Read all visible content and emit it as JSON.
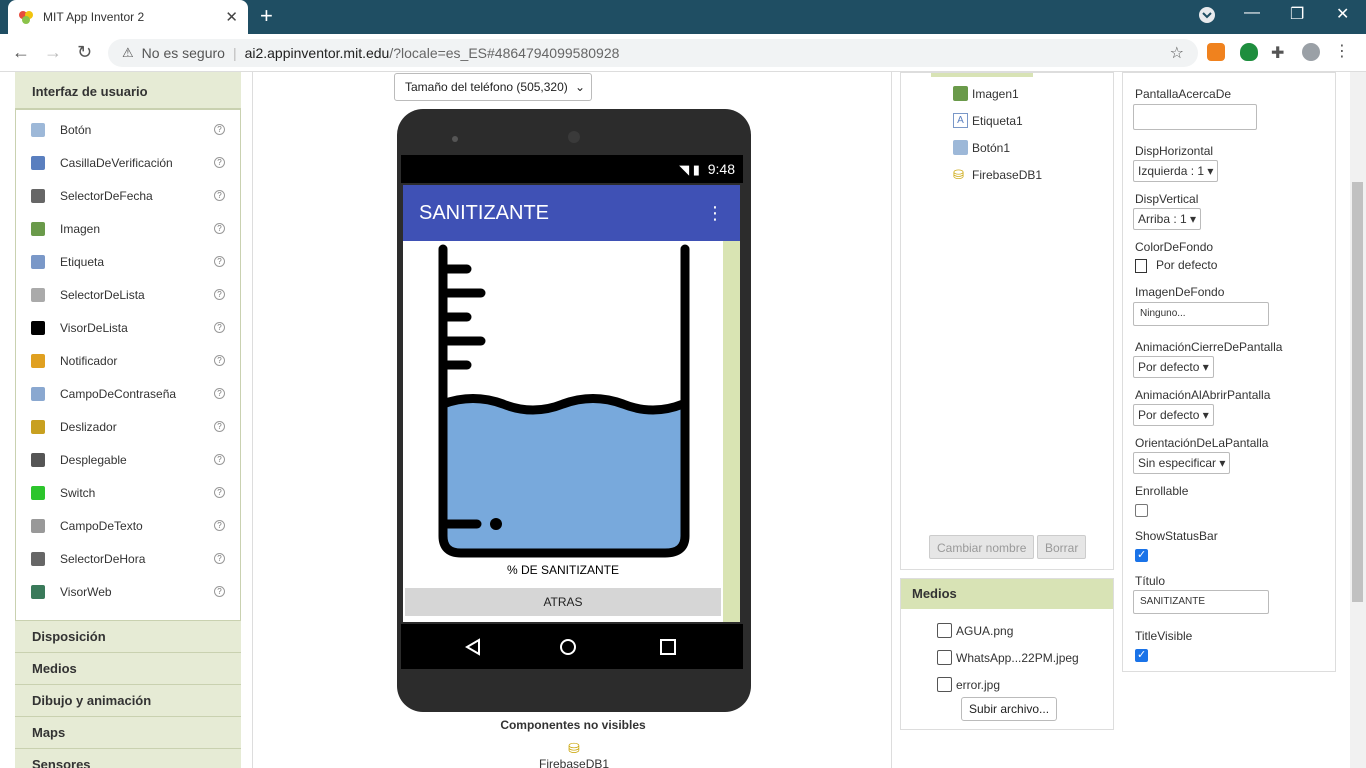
{
  "browser": {
    "tab_title": "MIT App Inventor 2",
    "tab_close": "✕",
    "new_tab": "+",
    "security": "No es seguro",
    "url_host": "ai2.appinventor.mit.edu",
    "url_path": "/?locale=es_ES#4864794099580928",
    "window_controls": [
      "—",
      "❐",
      "✕"
    ]
  },
  "palette": {
    "header": "Interfaz de usuario",
    "items": [
      {
        "label": "Botón",
        "icon": "button-icon",
        "color": "#9db8d8"
      },
      {
        "label": "CasillaDeVerificación",
        "icon": "checkbox-icon",
        "color": "#5a7fbf"
      },
      {
        "label": "SelectorDeFecha",
        "icon": "date-picker-icon",
        "color": "#666"
      },
      {
        "label": "Imagen",
        "icon": "image-icon",
        "color": "#6a9a4a"
      },
      {
        "label": "Etiqueta",
        "icon": "label-icon",
        "color": "#7a98c8"
      },
      {
        "label": "SelectorDeLista",
        "icon": "list-picker-icon",
        "color": "#aaa"
      },
      {
        "label": "VisorDeLista",
        "icon": "list-view-icon",
        "color": "#000"
      },
      {
        "label": "Notificador",
        "icon": "notifier-icon",
        "color": "#e0a020"
      },
      {
        "label": "CampoDeContraseña",
        "icon": "password-icon",
        "color": "#8aa8d0"
      },
      {
        "label": "Deslizador",
        "icon": "slider-icon",
        "color": "#c8a020"
      },
      {
        "label": "Desplegable",
        "icon": "spinner-icon",
        "color": "#555"
      },
      {
        "label": "Switch",
        "icon": "switch-icon",
        "color": "#2cc52c"
      },
      {
        "label": "CampoDeTexto",
        "icon": "textbox-icon",
        "color": "#999"
      },
      {
        "label": "SelectorDeHora",
        "icon": "time-picker-icon",
        "color": "#666"
      },
      {
        "label": "VisorWeb",
        "icon": "webviewer-icon",
        "color": "#3a7a5a"
      }
    ],
    "categories": [
      "Disposición",
      "Medios",
      "Dibujo y animación",
      "Maps",
      "Sensores"
    ]
  },
  "viewer": {
    "size_select": "Tamaño del teléfono (505,320)",
    "status_time": "9:48",
    "app_title": "SANITIZANTE",
    "caption": "% DE SANITIZANTE",
    "button": "ATRAS",
    "nonvisible_header": "Componentes no visibles",
    "nonvisible_item": "FirebaseDB1"
  },
  "components": {
    "items": [
      "Imagen1",
      "Etiqueta1",
      "Botón1",
      "FirebaseDB1"
    ],
    "rename": "Cambiar nombre",
    "delete": "Borrar"
  },
  "media": {
    "header": "Medios",
    "files": [
      "AGUA.png",
      "WhatsApp...22PM.jpeg",
      "error.jpg"
    ],
    "upload": "Subir archivo..."
  },
  "properties": {
    "about_label": "PantallaAcercaDe",
    "halign_label": "DispHorizontal",
    "halign_value": "Izquierda : 1",
    "valign_label": "DispVertical",
    "valign_value": "Arriba : 1",
    "bgcolor_label": "ColorDeFondo",
    "bgcolor_value": "Por defecto",
    "bgimage_label": "ImagenDeFondo",
    "bgimage_value": "Ninguno...",
    "close_anim_label": "AnimaciónCierreDePantalla",
    "close_anim_value": "Por defecto",
    "open_anim_label": "AnimaciónAlAbrirPantalla",
    "open_anim_value": "Por defecto",
    "orientation_label": "OrientaciónDeLaPantalla",
    "orientation_value": "Sin especificar",
    "scrollable_label": "Enrollable",
    "statusbar_label": "ShowStatusBar",
    "title_label": "Título",
    "title_value": "SANITIZANTE",
    "titlevisible_label": "TitleVisible"
  }
}
